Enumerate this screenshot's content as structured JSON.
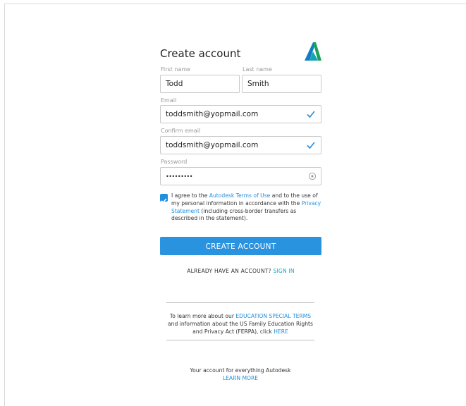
{
  "form": {
    "title": "Create account",
    "first_name_label": "First name",
    "first_name_value": "Todd",
    "last_name_label": "Last name",
    "last_name_value": "Smith",
    "email_label": "Email",
    "email_value": "toddsmith@yopmail.com",
    "confirm_email_label": "Confirm email",
    "confirm_email_value": "toddsmith@yopmail.com",
    "password_label": "Password",
    "password_value": "•••••••••"
  },
  "agreement": {
    "checked": true,
    "prefix": "I agree to the ",
    "terms_link": "Autodesk Terms of Use",
    "middle": " and to the use of my personal information in accordance with the ",
    "privacy_link": "Privacy Statement",
    "suffix": " (including cross-border transfers as described in the statement)."
  },
  "create_button_label": "CREATE ACCOUNT",
  "signin": {
    "prompt": "ALREADY HAVE AN ACCOUNT? ",
    "link": "SIGN IN"
  },
  "education": {
    "prefix": "To learn more about our ",
    "terms_link": "EDUCATION SPECIAL TERMS",
    "middle": " and information about the US Family Education Rights and Privacy Act (FERPA), click ",
    "here_link": "HERE"
  },
  "footer": {
    "tagline": "Your account for everything Autodesk",
    "learn_more": "LEARN MORE"
  },
  "colors": {
    "accent": "#2a93df",
    "teal_link": "#18a4b8",
    "checkmark": "#1f8fe0"
  },
  "icons": [
    "autodesk-logo",
    "check-icon",
    "eye-icon",
    "checkbox-checked-icon"
  ]
}
